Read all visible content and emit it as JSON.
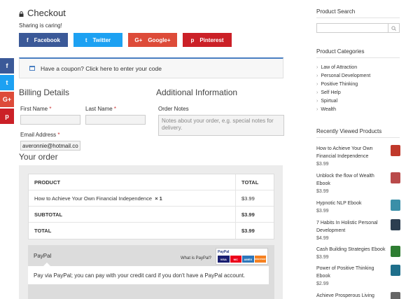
{
  "main": {
    "title": "Checkout",
    "sharing_text": "Sharing is caring!",
    "share_buttons": [
      {
        "label": "Facebook",
        "icon": "f",
        "color": "#3b5998"
      },
      {
        "label": "Twitter",
        "icon": "t",
        "color": "#1da1f2"
      },
      {
        "label": "Google+",
        "icon": "G+",
        "color": "#dd4b39"
      },
      {
        "label": "Pinterest",
        "icon": "p",
        "color": "#cb2027"
      }
    ],
    "coupon_text": "Have a coupon? Click here to enter your code"
  },
  "floating_share": [
    {
      "icon": "f",
      "color": "#3b5998"
    },
    {
      "icon": "t",
      "color": "#1da1f2"
    },
    {
      "icon": "G+",
      "color": "#dd4b39"
    },
    {
      "icon": "p",
      "color": "#cb2027"
    }
  ],
  "billing": {
    "heading": "Billing Details",
    "first_name_label": "First Name",
    "last_name_label": "Last Name",
    "email_label": "Email Address",
    "required_mark": "*",
    "email_value": "averonnie@hotmail.co",
    "first_name_value": "",
    "last_name_value": ""
  },
  "additional": {
    "heading": "Additional Information",
    "notes_label": "Order Notes",
    "notes_placeholder": "Notes about your order, e.g. special notes for delivery."
  },
  "order": {
    "heading": "Your order",
    "col_product": "PRODUCT",
    "col_total": "TOTAL",
    "item_name": "How to Achieve Your Own Financial Independence",
    "item_qty": "× 1",
    "item_total": "$3.99",
    "subtotal_label": "SUBTOTAL",
    "subtotal_value": "$3.99",
    "total_label": "TOTAL",
    "total_value": "$3.99"
  },
  "payment": {
    "method": "PayPal",
    "what_is": "What is PayPal?",
    "logo_text": "PayPal",
    "cards": [
      "VISA",
      "MC",
      "AMEX",
      "DISCOVER"
    ],
    "description": "Pay via PayPal; you can pay with your credit card if you don't have a PayPal account."
  },
  "sidebar": {
    "search_title": "Product Search",
    "categories_title": "Product Categories",
    "categories": [
      "Law of Attraction",
      "Personal Development",
      "Positive Thinking",
      "Self Help",
      "Spirtual",
      "Wealth"
    ],
    "recent_title": "Recently Viewed Products",
    "recent": [
      {
        "title": "How to Achieve Your Own Financial Independence",
        "price": "$3.99",
        "color": "#c0392b"
      },
      {
        "title": "Unblock the flow of Wealth Ebook",
        "price": "$3.99",
        "color": "#b94a4a"
      },
      {
        "title": "Hypnotic NLP Ebook",
        "price": "$3.99",
        "color": "#3a8fa8"
      },
      {
        "title": "7 Habits In Holistic Personal Development",
        "price": "$4.99",
        "color": "#2c3e50"
      },
      {
        "title": "Cash Building Strategies Ebook",
        "price": "$3.99",
        "color": "#2e7d32"
      },
      {
        "title": "Power of Positive Thinking Ebook",
        "price": "$2.99",
        "color": "#1f6f8b"
      },
      {
        "title": "Achieve Prosperous Living",
        "price": "",
        "color": "#666666"
      }
    ]
  }
}
